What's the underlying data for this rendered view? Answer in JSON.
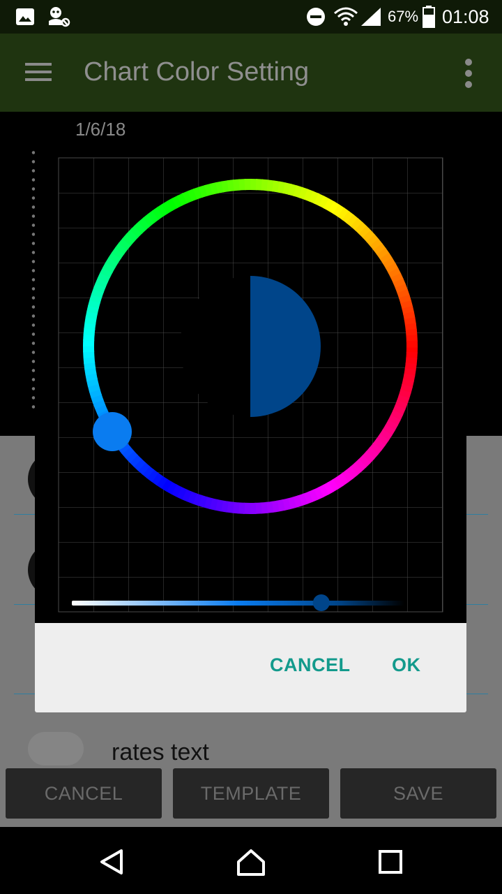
{
  "status_bar": {
    "battery_percent": "67%",
    "time": "01:08",
    "icons": [
      "image-icon",
      "usb-debug-icon",
      "do-not-disturb-icon",
      "wifi-icon",
      "signal-icon",
      "battery-icon"
    ]
  },
  "app_bar": {
    "title": "Chart Color Setting",
    "icons": [
      "menu-icon",
      "overflow-menu-icon"
    ]
  },
  "background": {
    "chart_date": "1/6/18",
    "list_item_text": "rates text",
    "buttons": {
      "cancel": "CANCEL",
      "template": "TEMPLATE",
      "save": "SAVE"
    }
  },
  "color_picker": {
    "selected_color": "#00458A",
    "previous_color": "#000000",
    "hue_selector_color": "#0a7cf0",
    "value_slider_level": 0.75,
    "buttons": {
      "cancel": "CANCEL",
      "ok": "OK"
    }
  },
  "nav_bar": {
    "icons": [
      "back-icon",
      "home-icon",
      "recents-icon"
    ]
  }
}
